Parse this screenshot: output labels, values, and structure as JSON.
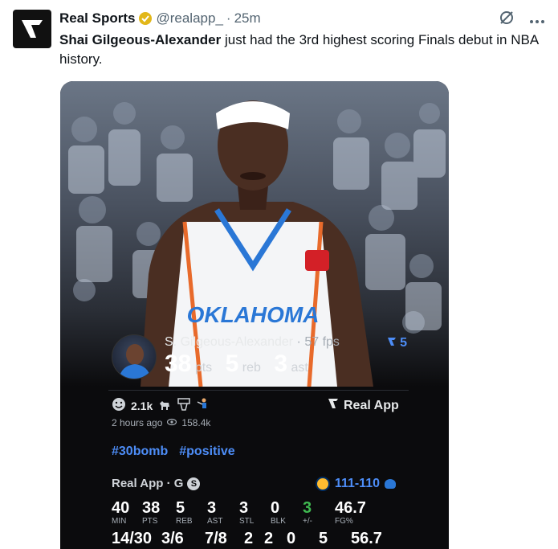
{
  "tweet": {
    "author_name": "Real Sports",
    "handle": "@realapp_",
    "separator": "·",
    "time": "25m",
    "text_bold": "Shai Gilgeous-Alexander",
    "text_rest": " just had the 3rd highest scoring Finals debut in NBA history."
  },
  "icons": {
    "verified": "verified-badge-icon",
    "grok": "grok-icon",
    "more": "more-icon"
  },
  "card": {
    "player_name": "S. Gilgeous-Alexander",
    "fps_sep": "·",
    "fps": "57 fps",
    "vote_count": "5",
    "stats": [
      {
        "num": "38",
        "label": "pts"
      },
      {
        "num": "5",
        "label": "reb"
      },
      {
        "num": "3",
        "label": "ast"
      }
    ],
    "reactions_count": "2.1k",
    "brand": "Real App",
    "posted": "2 hours ago",
    "views": "158.4k",
    "tags": [
      "#30bomb",
      "#positive"
    ],
    "game_source": "Real App · G",
    "badge": "S",
    "score": "111-110",
    "row1_values": [
      "40",
      "38",
      "5",
      "3",
      "3",
      "0",
      "3",
      "46.7"
    ],
    "row1_labels": [
      "MIN",
      "PTS",
      "REB",
      "AST",
      "STL",
      "BLK",
      "+/-",
      "FG%"
    ],
    "row2_values": [
      "14/30",
      "3/6",
      "7/8",
      "2",
      "2",
      "0",
      "5",
      "56.7"
    ]
  },
  "colors": {
    "accent_blue": "#4d8df7",
    "positive_green": "#3fb950",
    "card_bg": "#0b0b0d"
  }
}
